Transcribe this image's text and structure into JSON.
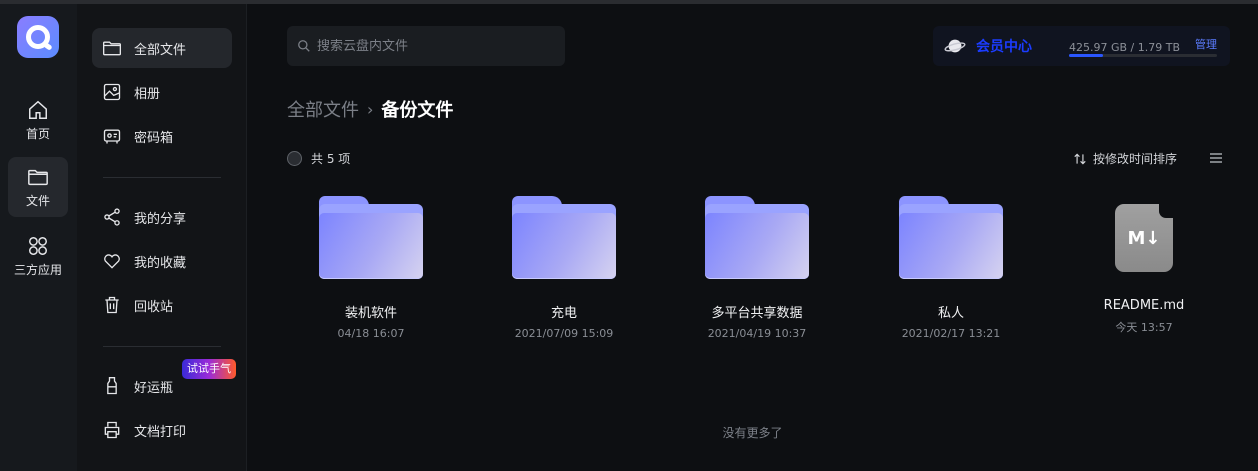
{
  "rail": {
    "items": [
      {
        "label": "首页",
        "icon": "home-icon"
      },
      {
        "label": "文件",
        "icon": "folder-icon"
      },
      {
        "label": "三方应用",
        "icon": "apps-grid-icon"
      }
    ]
  },
  "sidebar": {
    "items": [
      {
        "label": "全部文件",
        "icon": "folder-icon"
      },
      {
        "label": "相册",
        "icon": "photo-icon"
      },
      {
        "label": "密码箱",
        "icon": "safe-box-icon"
      },
      {
        "label": "我的分享",
        "icon": "share-icon"
      },
      {
        "label": "我的收藏",
        "icon": "heart-icon"
      },
      {
        "label": "回收站",
        "icon": "trash-icon"
      },
      {
        "label": "好运瓶",
        "icon": "bottle-icon"
      },
      {
        "label": "文档打印",
        "icon": "printer-icon"
      }
    ],
    "trial_badge": "试试手气"
  },
  "search": {
    "placeholder": "搜索云盘内文件"
  },
  "vip": {
    "label": "会员中心",
    "quota_text": "425.97 GB / 1.79 TB",
    "manage_label": "管理",
    "used_fraction": 0.232
  },
  "breadcrumb": {
    "parent": "全部文件",
    "separator": "›",
    "current": "备份文件"
  },
  "toolbar": {
    "count_text": "共 5 项",
    "sort_label": "按修改时间排序"
  },
  "files": [
    {
      "name": "装机软件",
      "date": "04/18 16:07",
      "type": "folder"
    },
    {
      "name": "充电",
      "date": "2021/07/09 15:09",
      "type": "folder"
    },
    {
      "name": "多平台共享数据",
      "date": "2021/04/19 10:37",
      "type": "folder"
    },
    {
      "name": "私人",
      "date": "2021/02/17 13:21",
      "type": "folder"
    },
    {
      "name": "README.md",
      "date": "今天 13:57",
      "type": "markdown"
    }
  ],
  "markdown_badge": "M↓",
  "footer": {
    "no_more": "没有更多了"
  },
  "colors": {
    "accent": "#5b7cff",
    "vip": "#1b3cff",
    "folder": "#8c94ff"
  }
}
